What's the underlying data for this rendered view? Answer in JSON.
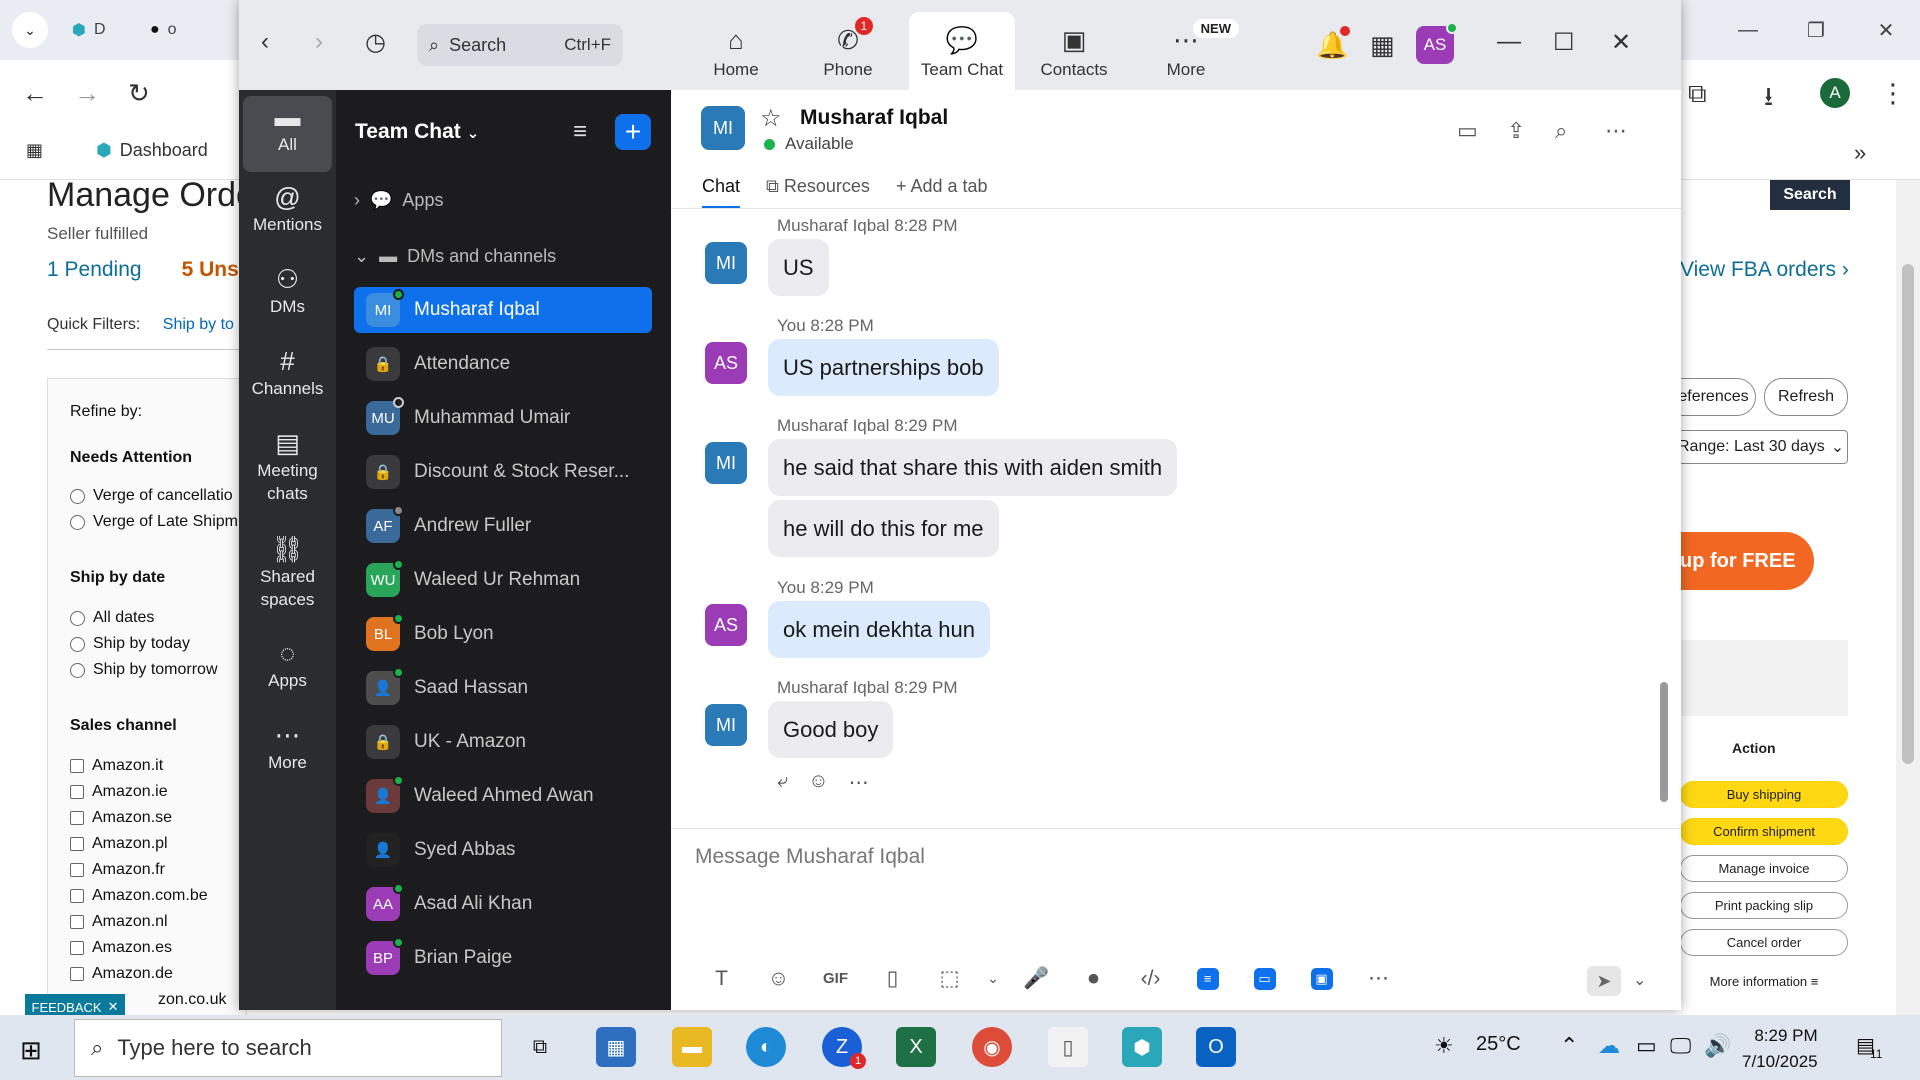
{
  "browser": {
    "tabs": [
      {
        "label": "D"
      },
      {
        "label": "o"
      }
    ],
    "bookmark_dashboard": "Dashboard"
  },
  "amazon": {
    "title": "Manage Orde",
    "seller_fulfilled": "Seller fulfilled",
    "tab_pending": "1 Pending",
    "tab_unshipped": "5 Uns",
    "quick_filters": "Quick Filters:",
    "quick_filter_ship": "Ship by to",
    "refine_by": "Refine by:",
    "needs_attention": "Needs Attention",
    "na_options": [
      "Verge of cancellatio",
      "Verge of Late Shipm"
    ],
    "ship_by_date": "Ship by date",
    "sbd_options": [
      "All dates",
      "Ship by today",
      "Ship by tomorrow"
    ],
    "sales_channel": "Sales channel",
    "channels": [
      "Amazon.it",
      "Amazon.ie",
      "Amazon.se",
      "Amazon.pl",
      "Amazon.fr",
      "Amazon.com.be",
      "Amazon.nl",
      "Amazon.es",
      "Amazon.de",
      "zon.co.uk"
    ],
    "search_button": "Search",
    "view_fba": "View FBA orders ›",
    "preferences": "eferences",
    "refresh": "Refresh",
    "range": "Range: Last 30 days",
    "signup": "up for FREE",
    "action": "Action",
    "actions": [
      "Buy shipping",
      "Confirm shipment",
      "Manage invoice",
      "Print packing slip",
      "Cancel order",
      "More information ≡"
    ],
    "feedback": "FEEDBACK"
  },
  "zoom": {
    "search_label": "Search",
    "search_shortcut": "Ctrl+F",
    "nav_tabs": [
      {
        "label": "Home",
        "icon": "home-icon"
      },
      {
        "label": "Phone",
        "icon": "phone-icon",
        "badge": "1"
      },
      {
        "label": "Team Chat",
        "icon": "chat-icon"
      },
      {
        "label": "Contacts",
        "icon": "contacts-icon"
      },
      {
        "label": "More",
        "icon": "more-icon",
        "badge": "NEW"
      }
    ],
    "user_initials": "AS",
    "rail": [
      {
        "label": "All"
      },
      {
        "label": "Mentions"
      },
      {
        "label": "DMs"
      },
      {
        "label": "Channels"
      },
      {
        "label": "Meeting chats"
      },
      {
        "label": "Shared spaces"
      },
      {
        "label": "Apps"
      },
      {
        "label": "More"
      }
    ],
    "list_title": "Team Chat",
    "section_apps": "Apps",
    "section_dms": "DMs and channels",
    "contacts": [
      {
        "initials": "MI",
        "name": "Musharaf Iqbal",
        "color": "#2a7ab8"
      },
      {
        "initials": "",
        "name": "Attendance",
        "color": "#3a3a3d"
      },
      {
        "initials": "MU",
        "name": "Muhammad Umair",
        "color": "#3a6a9a"
      },
      {
        "initials": "",
        "name": "Discount & Stock Reser...",
        "color": "#3a3a3d"
      },
      {
        "initials": "AF",
        "name": "Andrew Fuller",
        "color": "#3a6a9a"
      },
      {
        "initials": "WU",
        "name": "Waleed Ur Rehman",
        "color": "#2aa65a"
      },
      {
        "initials": "BL",
        "name": "Bob Lyon",
        "color": "#e0731f"
      },
      {
        "initials": "",
        "name": "Saad Hassan",
        "color": "#4d4d4d"
      },
      {
        "initials": "",
        "name": "UK - Amazon",
        "color": "#3a3a3d"
      },
      {
        "initials": "",
        "name": "Waleed Ahmed Awan",
        "color": "#6b3a3a"
      },
      {
        "initials": "",
        "name": "Syed Abbas",
        "color": "#222"
      },
      {
        "initials": "AA",
        "name": "Asad Ali Khan",
        "color": "#9b3bb5"
      },
      {
        "initials": "BP",
        "name": "Brian Paige",
        "color": "#9b3bb5"
      }
    ],
    "chat": {
      "name": "Musharaf Iqbal",
      "initials": "MI",
      "status": "Available",
      "tabs": [
        "Chat",
        "Resources",
        "Add a tab"
      ],
      "messages": [
        {
          "meta_name": "Musharaf Iqbal",
          "time": "8:28 PM",
          "initials": "MI",
          "text": "US"
        },
        {
          "meta_name": "You",
          "time": "8:28 PM",
          "initials": "AS",
          "text": "US partnerships bob"
        },
        {
          "meta_name": "Musharaf Iqbal",
          "time": "8:29 PM",
          "initials": "MI",
          "text": "he said that share this with aiden smith",
          "text2": "he will do this for me"
        },
        {
          "meta_name": "You",
          "time": "8:29 PM",
          "initials": "AS",
          "text": "ok mein dekhta hun"
        },
        {
          "meta_name": "Musharaf Iqbal",
          "time": "8:29 PM",
          "initials": "MI",
          "text": "Good boy"
        }
      ],
      "compose_placeholder": "Message Musharaf Iqbal"
    }
  },
  "taskbar": {
    "search_placeholder": "Type here to search",
    "temperature": "25°C",
    "time": "8:29 PM",
    "date": "7/10/2025",
    "notification_count": "11"
  }
}
